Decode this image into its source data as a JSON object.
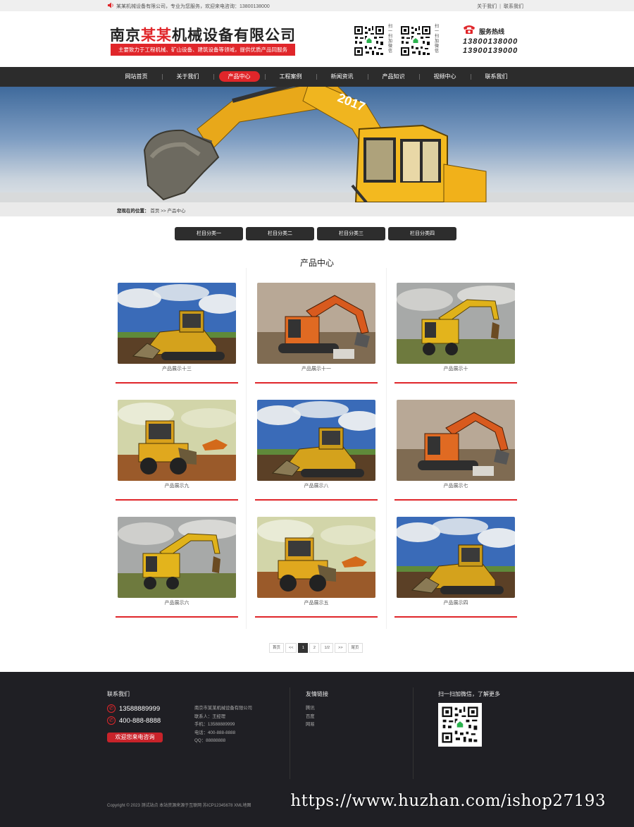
{
  "topbar": {
    "welcome": "某某机械设备有限公司，专业为您服务，欢迎来电咨询：13800138000",
    "links": [
      "关于我们",
      "联系我们"
    ]
  },
  "header": {
    "title_pre": "南京",
    "title_hl": "某某",
    "title_post": "机械设备有限公司",
    "slogan": "主要致力于工程机械、矿山设备、建筑设备等领域，提供优质产品同服务",
    "qr_text_1": "扫一扫加微信",
    "qr_text_2": "扫一扫加微信",
    "hotline_label": "服务热线",
    "hotline_1": "13800138000",
    "hotline_2": "13900139000"
  },
  "nav": {
    "items": [
      "网站首页",
      "关于我们",
      "产品中心",
      "工程案例",
      "新闻资讯",
      "产品知识",
      "视频中心",
      "联系我们"
    ],
    "active_index": 2
  },
  "banner": {
    "plate": "2017"
  },
  "breadcrumb": {
    "label": "您现在的位置：",
    "home": "首页",
    "sep": ">>",
    "current": "产品中心"
  },
  "categories": [
    "栏目分类一",
    "栏目分类二",
    "栏目分类三",
    "栏目分类四"
  ],
  "section_title": "产品中心",
  "products": [
    {
      "caption": "产品展示十三",
      "kind": "loader"
    },
    {
      "caption": "产品展示十一",
      "kind": "excavator-orange"
    },
    {
      "caption": "产品展示十",
      "kind": "wheel-excavator"
    },
    {
      "caption": "产品展示九",
      "kind": "wheel-loader"
    },
    {
      "caption": "产品展示八",
      "kind": "loader"
    },
    {
      "caption": "产品展示七",
      "kind": "excavator-orange"
    },
    {
      "caption": "产品展示六",
      "kind": "wheel-excavator"
    },
    {
      "caption": "产品展示五",
      "kind": "wheel-loader"
    },
    {
      "caption": "产品展示四",
      "kind": "loader"
    }
  ],
  "pager": [
    "首页",
    "<<",
    "1",
    "2",
    "1/2",
    ">>",
    "尾页"
  ],
  "pager_current": "1",
  "footer": {
    "contact_title": "联系我们",
    "phone_1": "13588889999",
    "phone_2": "400-888-8888",
    "consult": "欢迎您来电咨询",
    "info": [
      "南京市某某机械设备有限公司",
      "联系人：王经理",
      "手机：13588889999",
      "电话：400-888-8888",
      "QQ：88888888"
    ],
    "links_title": "友情链接",
    "links": [
      "腾讯",
      "百度",
      "网易"
    ],
    "wechat_title": "扫一扫加微信，了解更多",
    "copyright": "Copyright © 2023 测试站点 本站资源来源于互联网 苏ICP12345678 XML地图"
  },
  "watermark": "https://www.huzhan.com/ishop27193",
  "colors": {
    "accent": "#e0262a",
    "nav_bg": "#2c2c2c",
    "footer_bg": "#1f1f24"
  }
}
